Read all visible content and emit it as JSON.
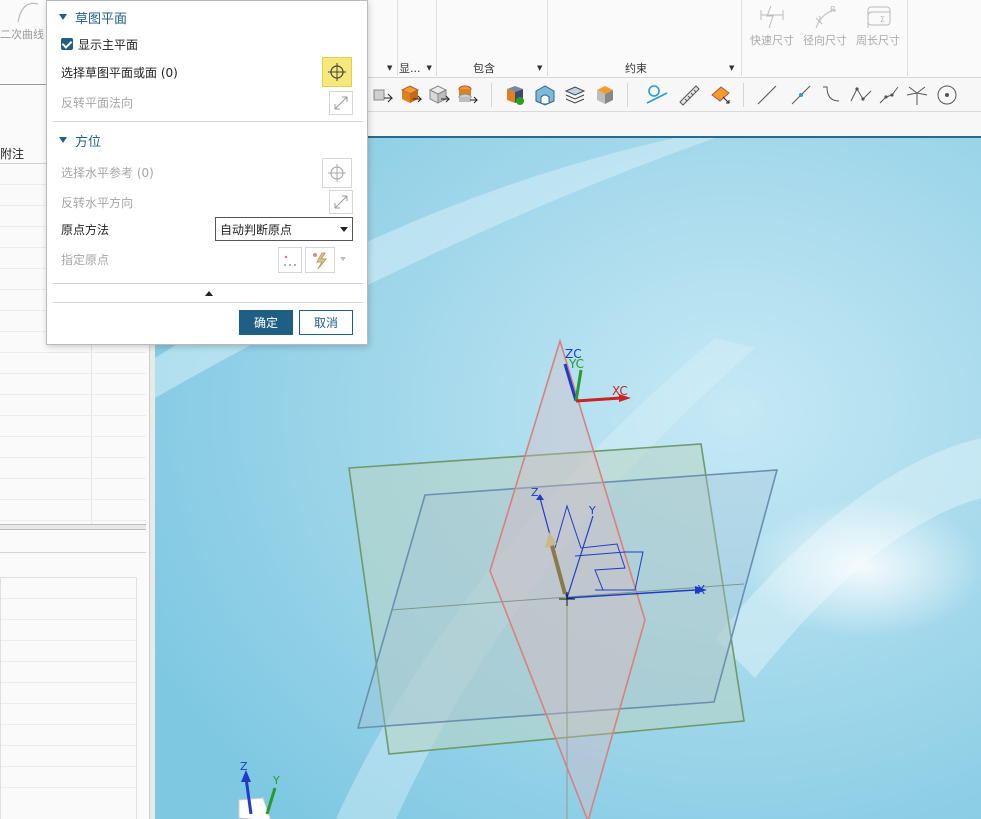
{
  "left_panel": {
    "curve_tool_label": "二次曲线",
    "column_header": "附注"
  },
  "ribbon": {
    "groups": [
      {
        "label": "显..."
      },
      {
        "label": "包含"
      },
      {
        "label": "约束"
      }
    ],
    "dimension_tools": [
      {
        "label": "快速尺寸",
        "icon": "quick-dimension-icon"
      },
      {
        "label": "径向尺寸",
        "icon": "radial-dimension-icon"
      },
      {
        "label": "周长尺寸",
        "icon": "perimeter-dimension-icon"
      }
    ]
  },
  "dialog": {
    "section_sketch_plane": "草图平面",
    "show_main_plane": "显示主平面",
    "select_plane": "选择草图平面或面 (0)",
    "reverse_normal": "反转平面法向",
    "section_orientation": "方位",
    "select_horizontal_ref": "选择水平参考 (0)",
    "reverse_horizontal": "反转水平方向",
    "origin_method_label": "原点方法",
    "origin_method_value": "自动判断原点",
    "specify_origin": "指定原点",
    "ok": "确定",
    "cancel": "取消"
  },
  "viewport": {
    "triad_labels": {
      "zc": "ZC",
      "yc": "YC",
      "xc": "XC"
    },
    "sketch_axes": {
      "z": "Z",
      "y": "Y",
      "x": "X"
    },
    "corner_triad": {
      "z": "Z",
      "y": "Y"
    },
    "colors": {
      "background": "#8fd0e6",
      "plane_green": "#6f9a6a",
      "plane_blue": "#6a90b0",
      "plane_red": "#d98080",
      "axis_blue": "#1e3cc8",
      "axis_red": "#cc2222",
      "axis_green": "#2a9a2a"
    }
  }
}
